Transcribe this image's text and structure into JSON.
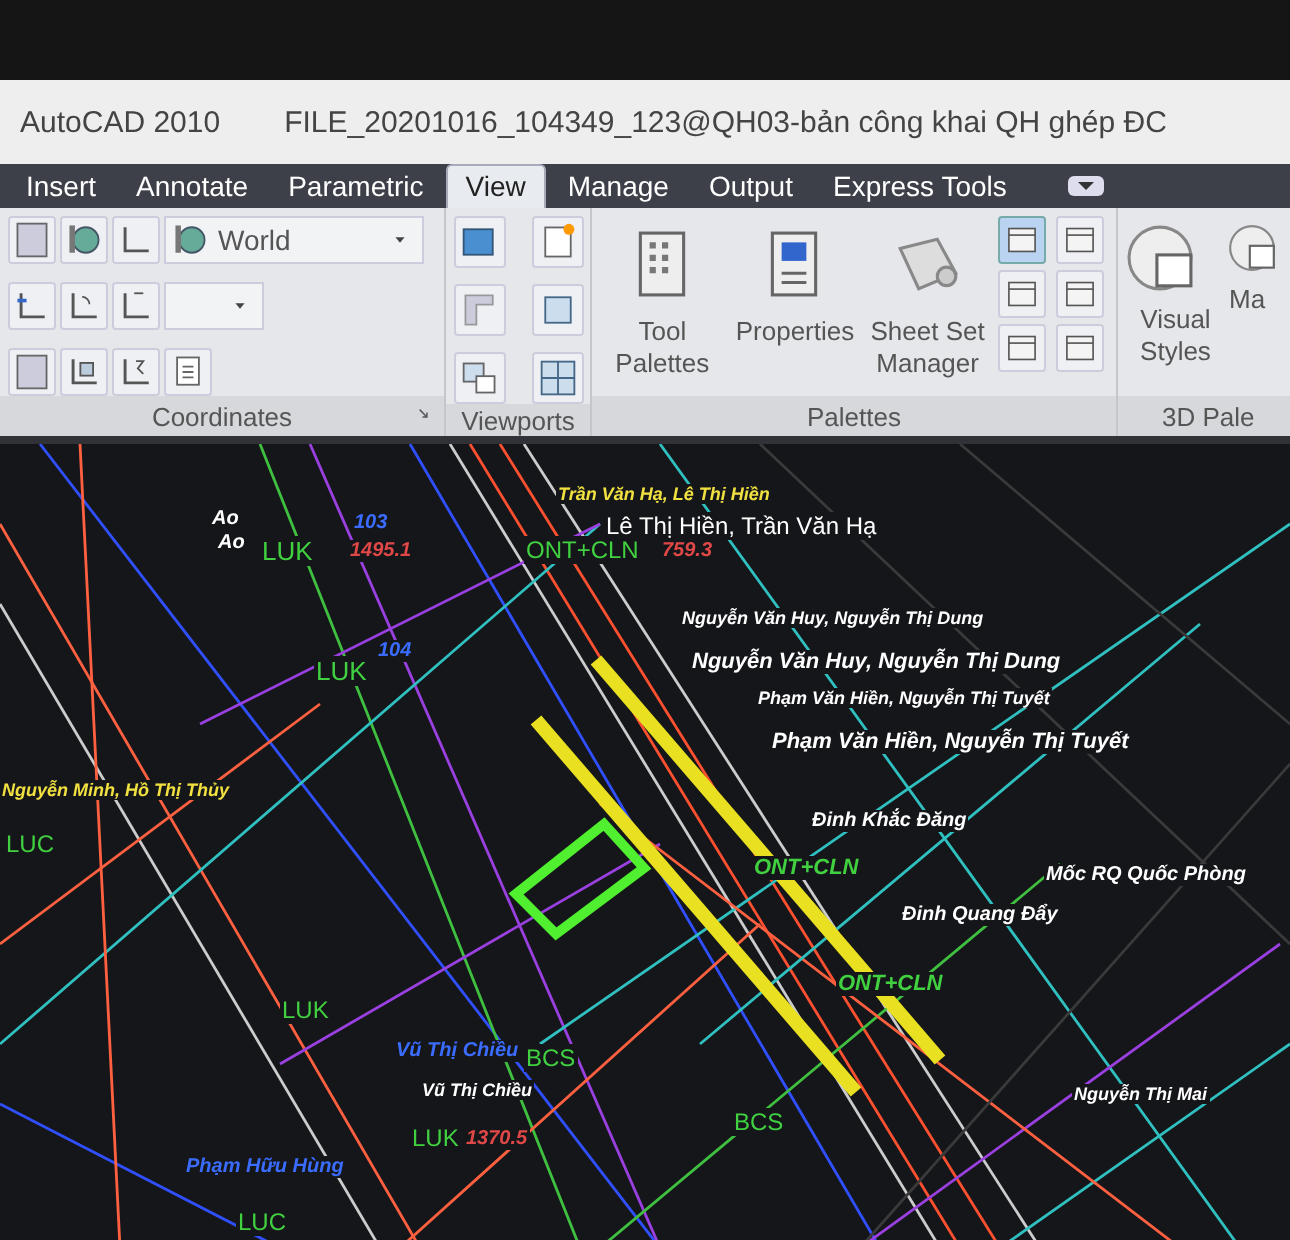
{
  "window": {
    "app": "AutoCAD 2010",
    "title": "FILE_20201016_104349_123@QH03-bản công khai QH ghép ĐC"
  },
  "tabs": [
    {
      "label": "Insert",
      "selected": false
    },
    {
      "label": "Annotate",
      "selected": false
    },
    {
      "label": "Parametric",
      "selected": false
    },
    {
      "label": "View",
      "selected": true
    },
    {
      "label": "Manage",
      "selected": false
    },
    {
      "label": "Output",
      "selected": false
    },
    {
      "label": "Express Tools",
      "selected": false
    }
  ],
  "panels": {
    "coordinates": {
      "title": "Coordinates",
      "ucs": "World"
    },
    "viewports": {
      "title": "Viewports"
    },
    "palettes": {
      "title": "Palettes",
      "buttons": [
        {
          "label": "Tool Palettes",
          "kind": "grid"
        },
        {
          "label": "Properties",
          "kind": "sheet"
        },
        {
          "label": "Sheet Set Manager",
          "kind": "roll"
        }
      ]
    },
    "palettes_3d": {
      "title": "3D Pale",
      "buttons": [
        {
          "label": "Visual Styles"
        },
        {
          "label": "Ma"
        }
      ]
    }
  },
  "drawing_labels": [
    {
      "text": "Ao",
      "color": "#ffffff"
    },
    {
      "text": "Ao",
      "color": "#ffffff"
    },
    {
      "text": "LUK",
      "color": "#40d040"
    },
    {
      "text": "103",
      "color": "#3a6cff"
    },
    {
      "text": "1495.1",
      "color": "#e04848"
    },
    {
      "text": "Trần Văn Hạ, Lê Thị Hiền",
      "color": "#f0e040"
    },
    {
      "text": "Lê Thị Hiền, Trần Văn Hạ",
      "color": "#ffffff"
    },
    {
      "text": "ONT+CLN",
      "color": "#40d040"
    },
    {
      "text": "759.3",
      "color": "#e04848"
    },
    {
      "text": "Nguyễn Văn Huy, Nguyễn Thị Dung",
      "color": "#ffffff"
    },
    {
      "text": "Nguyễn Văn Huy, Nguyễn Thị Dung",
      "color": "#ffffff"
    },
    {
      "text": "Phạm Văn Hiền, Nguyễn Thị Tuyết",
      "color": "#ffffff"
    },
    {
      "text": "Phạm Văn Hiền, Nguyễn Thị Tuyết",
      "color": "#ffffff"
    },
    {
      "text": "LUK",
      "color": "#40d040"
    },
    {
      "text": "104",
      "color": "#3a6cff"
    },
    {
      "text": "Nguyễn Minh, Hồ Thị Thủy",
      "color": "#f0e040"
    },
    {
      "text": "LUC",
      "color": "#40d040"
    },
    {
      "text": "Đinh Khắc Đăng",
      "color": "#ffffff"
    },
    {
      "text": "ONT+CLN",
      "color": "#40d040"
    },
    {
      "text": "Mốc RQ Quốc Phòng",
      "color": "#ffffff"
    },
    {
      "text": "Đinh Quang Đẩy",
      "color": "#ffffff"
    },
    {
      "text": "ONT+CLN",
      "color": "#40d040"
    },
    {
      "text": "LUK",
      "color": "#40d040"
    },
    {
      "text": "Vũ Thị Chiều",
      "color": "#3a6cff"
    },
    {
      "text": "BCS",
      "color": "#40d040"
    },
    {
      "text": "Vũ Thị Chiều",
      "color": "#ffffff"
    },
    {
      "text": "Nguyễn Thị Mai",
      "color": "#ffffff"
    },
    {
      "text": "LUK",
      "color": "#40d040"
    },
    {
      "text": "1370.5",
      "color": "#e04848"
    },
    {
      "text": "BCS",
      "color": "#40d040"
    },
    {
      "text": "Phạm Hữu Hùng",
      "color": "#3a6cff"
    },
    {
      "text": "LUC",
      "color": "#40d040"
    }
  ]
}
